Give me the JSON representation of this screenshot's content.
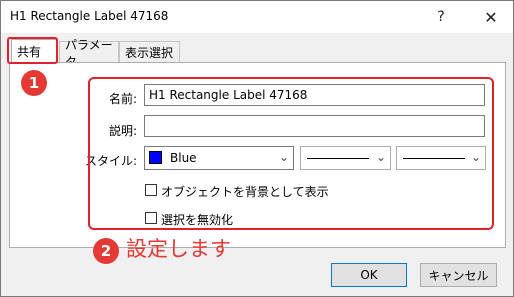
{
  "window": {
    "title": "H1 Rectangle Label 47168",
    "help_glyph": "?",
    "close_glyph": "✕"
  },
  "tabs": [
    {
      "label": "共有",
      "active": true
    },
    {
      "label": "パラメータ",
      "active": false
    },
    {
      "label": "表示選択",
      "active": false
    }
  ],
  "annotations": {
    "badge1": "1",
    "badge2": "2",
    "badge2_caption": "設定します",
    "highlight_color": "#e0202a"
  },
  "form": {
    "name_label": "名前:",
    "name_value": "H1 Rectangle Label 47168",
    "description_label": "説明:",
    "description_value": "",
    "style_label": "スタイル:",
    "color_value": "Blue",
    "color_swatch": "#0000ff",
    "chevron": "⌄",
    "chk_background_label": "オブジェクトを背景として表示",
    "chk_disable_selection_label": "選択を無効化"
  },
  "buttons": {
    "ok": "OK",
    "cancel": "キャンセル"
  }
}
